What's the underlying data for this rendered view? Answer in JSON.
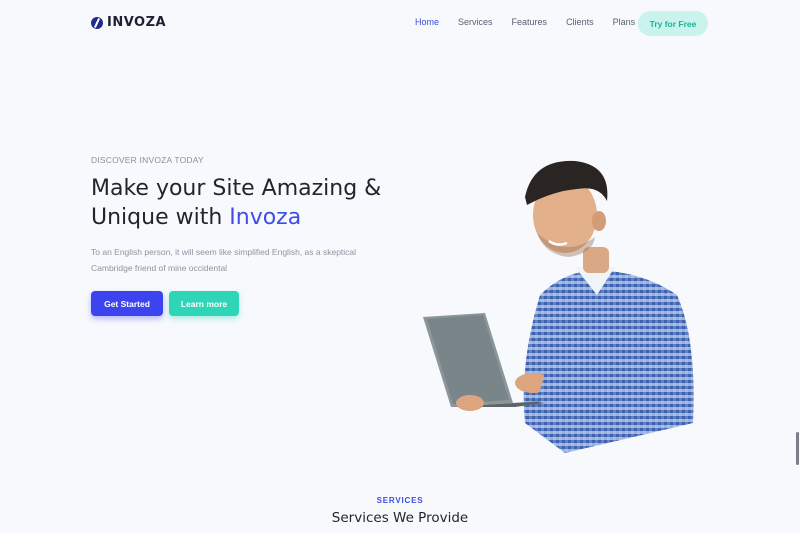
{
  "brand": {
    "name": "INVOZA",
    "icon": "invoza-logo-icon"
  },
  "nav": {
    "links": [
      {
        "label": "Home",
        "active": true
      },
      {
        "label": "Services",
        "active": false
      },
      {
        "label": "Features",
        "active": false
      },
      {
        "label": "Clients",
        "active": false
      },
      {
        "label": "Plans",
        "active": false
      }
    ],
    "cta_label": "Try for Free"
  },
  "hero": {
    "eyebrow": "DISCOVER INVOZA TODAY",
    "title_line1": "Make your Site Amazing &",
    "title_line2_prefix": "Unique with ",
    "title_accent": "Invoza",
    "description": "To an English person, it will seem like simplified English, as a skeptical Cambridge friend of mine occidental",
    "primary_button": "Get Started",
    "secondary_button": "Learn more"
  },
  "services": {
    "eyebrow": "SERVICES",
    "title": "Services We Provide"
  },
  "colors": {
    "accent": "#3e4ce8",
    "teal": "#2fd5b7",
    "background": "#f7f9fd"
  }
}
